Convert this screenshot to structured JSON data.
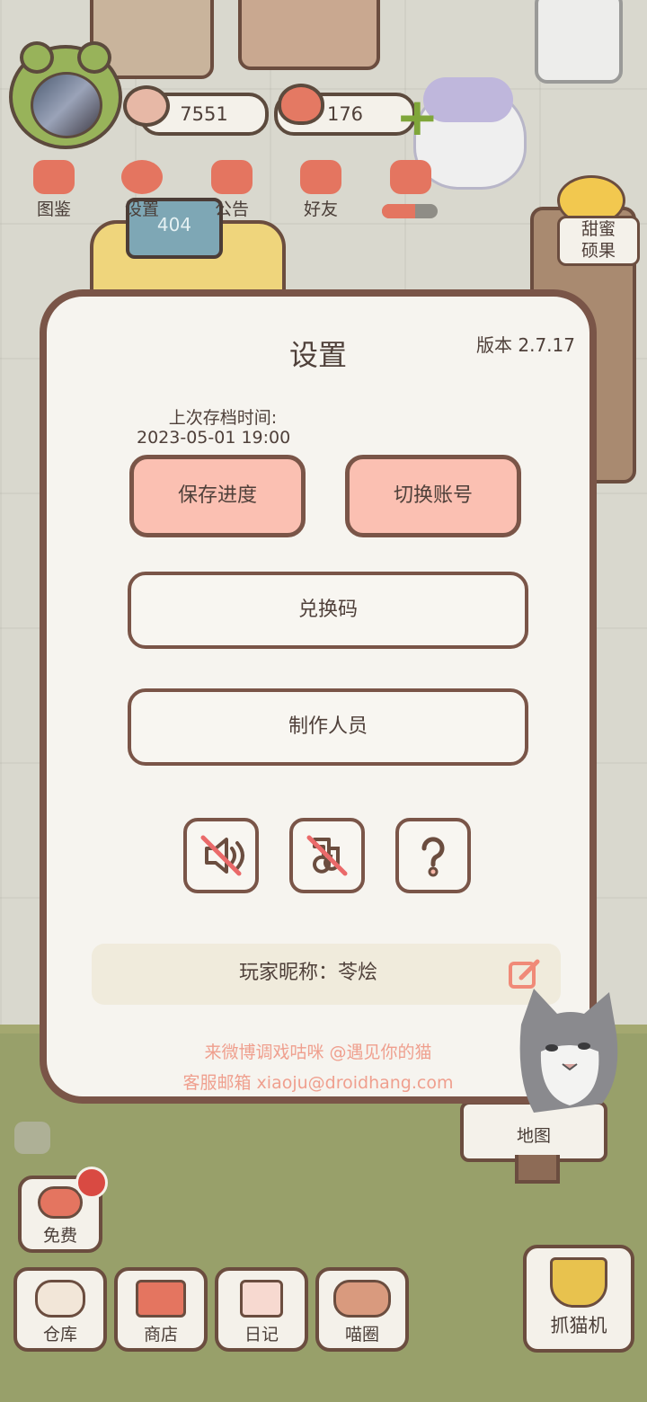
{
  "hud": {
    "coins": "7551",
    "hearts": "176",
    "top_menu": [
      {
        "label": "图鉴",
        "icon": "cat-book-icon"
      },
      {
        "label": "设置",
        "icon": "gear-icon"
      },
      {
        "label": "公告",
        "icon": "gift-icon"
      },
      {
        "label": "好友",
        "icon": "friends-icon"
      },
      {
        "label": "",
        "icon": "hearts-icon"
      }
    ],
    "hearts_progress": 0.6,
    "side_tag": "甜蜜\n硕果"
  },
  "dialog": {
    "title": "设置",
    "version": "版本 2.7.17",
    "last_save_label": "上次存档时间:",
    "last_save_time": "2023-05-01 19:00",
    "save_button": "保存进度",
    "switch_account_button": "切换账号",
    "redeem_code_button": "兑换码",
    "credits_button": "制作人员",
    "icon_buttons": [
      "sound-muted-icon",
      "music-muted-icon",
      "help-icon"
    ],
    "nickname": "玩家昵称：苓烩",
    "weibo": "来微博调戏咕咪 @遇见你的猫",
    "email": "客服邮箱 xiaoju@droidhang.com"
  },
  "bottom": {
    "map": "地图",
    "free": "免费",
    "warehouse": "仓库",
    "shop": "商店",
    "diary": "日记",
    "meow_circle": "喵圈",
    "claw_machine": "抓猫机"
  },
  "colors": {
    "accent": "#fbc0b2",
    "border": "#7a5548",
    "link": "#ef9f8e",
    "panel": "#f6f4ef"
  }
}
